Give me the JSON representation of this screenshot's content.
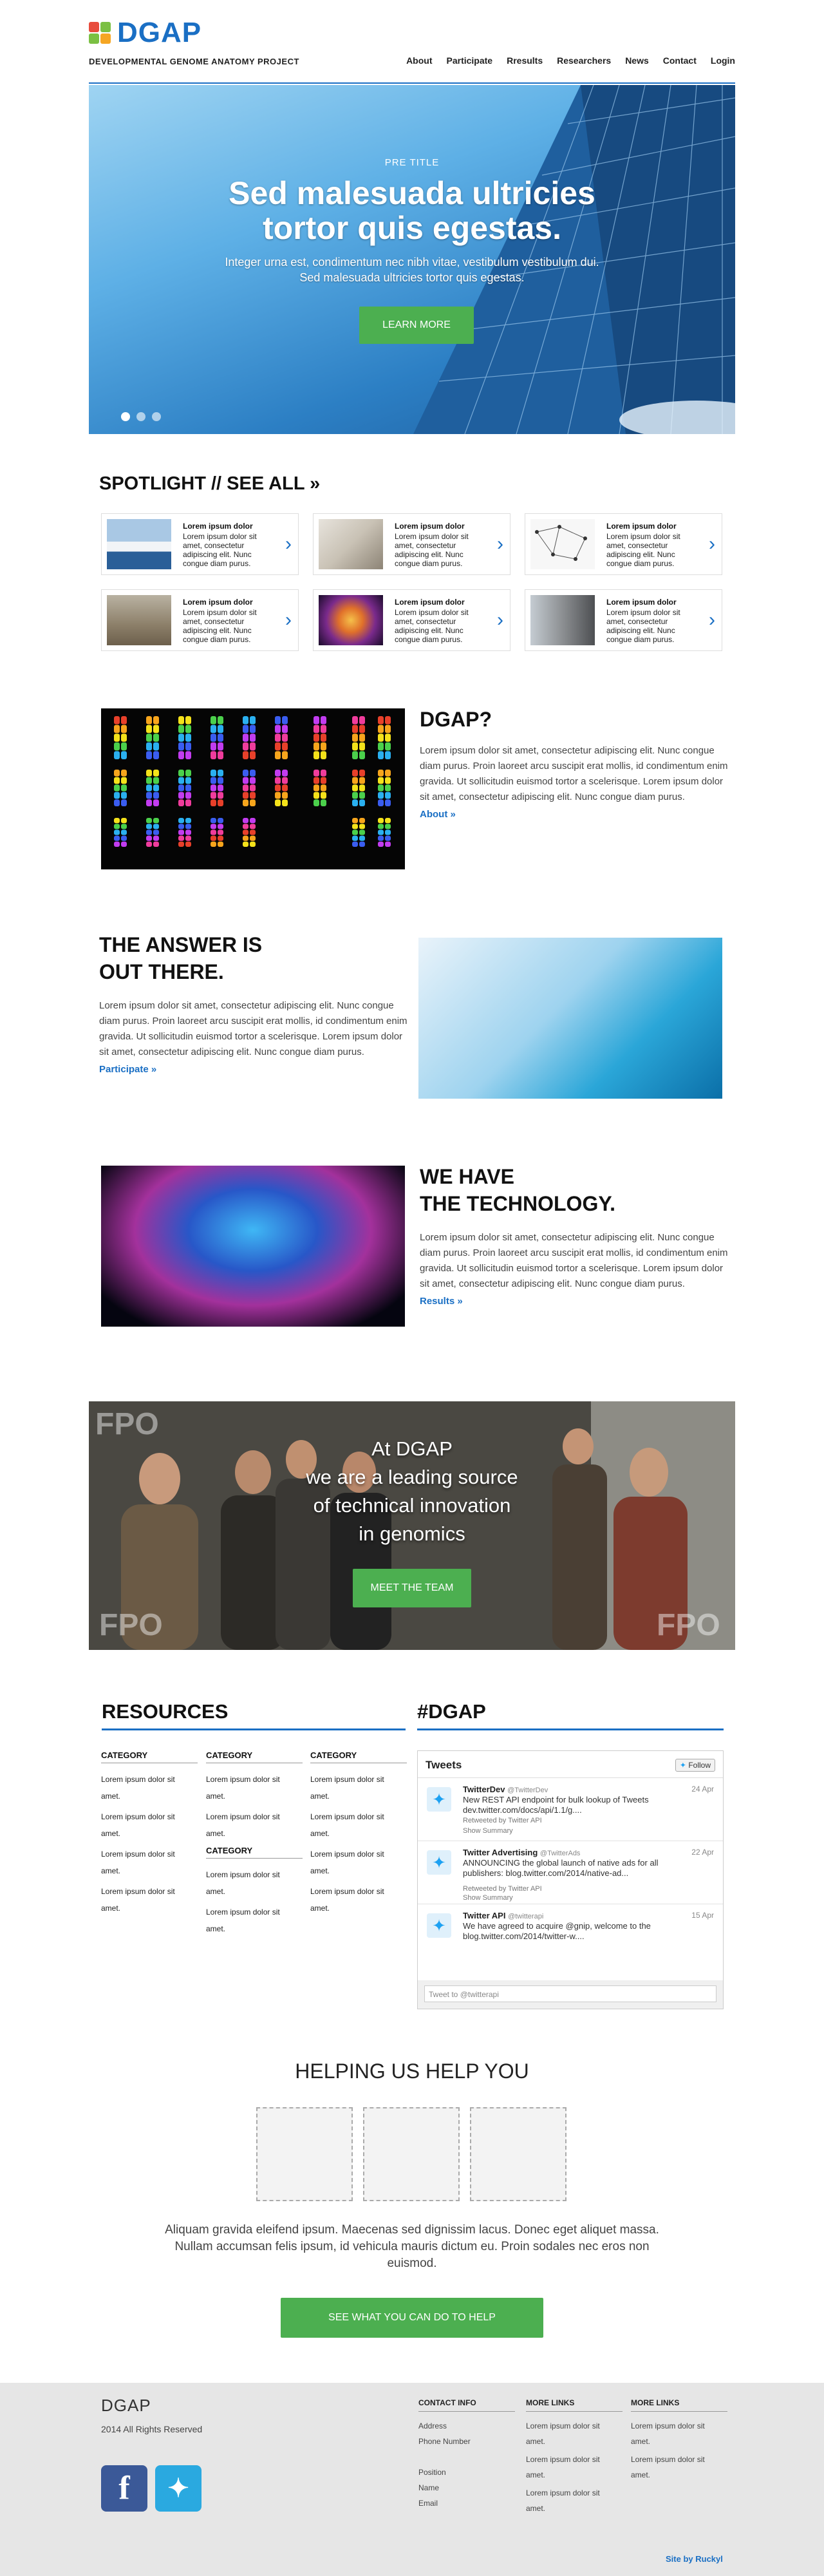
{
  "header": {
    "logo": "DGAP",
    "subtitle": "DEVELOPMENTAL GENOME ANATOMY PROJECT",
    "nav": [
      "About",
      "Participate",
      "Rresults",
      "Researchers",
      "News",
      "Contact",
      "Login"
    ]
  },
  "hero": {
    "pretitle": "PRE TITLE",
    "title_line1": "Sed malesuada ultricies",
    "title_line2": "tortor quis egestas.",
    "desc_line1": "Integer urna est, condimentum nec nibh vitae, vestibulum vestibulum dui.",
    "desc_line2": "Sed malesuada ultricies tortor quis egestas.",
    "button": "LEARN MORE"
  },
  "spotlight": {
    "heading": "SPOTLIGHT // SEE ALL »",
    "cards": [
      {
        "title": "Lorem ipsum dolor",
        "desc": "Lorem ipsum dolor sit amet, consectetur adipiscing elit. Nunc congue diam purus."
      },
      {
        "title": "Lorem ipsum dolor",
        "desc": "Lorem ipsum dolor sit amet, consectetur adipiscing elit. Nunc congue diam purus."
      },
      {
        "title": "Lorem ipsum dolor",
        "desc": "Lorem ipsum dolor sit amet, consectetur adipiscing elit. Nunc congue diam purus."
      },
      {
        "title": "Lorem ipsum dolor",
        "desc": "Lorem ipsum dolor sit amet, consectetur adipiscing elit. Nunc congue diam purus."
      },
      {
        "title": "Lorem ipsum dolor",
        "desc": "Lorem ipsum dolor sit amet, consectetur adipiscing elit. Nunc congue diam purus."
      },
      {
        "title": "Lorem ipsum dolor",
        "desc": "Lorem ipsum dolor sit amet, consectetur adipiscing elit. Nunc congue diam purus."
      }
    ]
  },
  "features": [
    {
      "title_line1": "DGAP?",
      "title_line2": "",
      "body": "Lorem ipsum dolor sit amet, consectetur adipiscing elit. Nunc congue diam purus. Proin laoreet arcu suscipit erat mollis, id condimentum enim gravida. Ut sollicitudin euismod tortor a scelerisque. Lorem ipsum dolor sit amet, consectetur adipiscing elit. Nunc congue diam purus.",
      "link": "About »"
    },
    {
      "title_line1": "THE ANSWER IS",
      "title_line2": "OUT THERE.",
      "body": "Lorem ipsum dolor sit amet, consectetur adipiscing elit. Nunc congue diam purus. Proin laoreet arcu suscipit erat mollis, id condimentum enim gravida. Ut sollicitudin euismod tortor a scelerisque. Lorem ipsum dolor sit amet, consectetur adipiscing elit. Nunc congue diam purus.",
      "link": "Participate »"
    },
    {
      "title_line1": "WE HAVE",
      "title_line2": "THE TECHNOLOGY.",
      "body": "Lorem ipsum dolor sit amet, consectetur adipiscing elit. Nunc congue diam purus. Proin laoreet arcu suscipit erat mollis, id condimentum enim gravida. Ut sollicitudin euismod tortor a scelerisque. Lorem ipsum dolor sit amet, consectetur adipiscing elit. Nunc congue diam purus.",
      "link": "Results »"
    }
  ],
  "team": {
    "line1": "At DGAP",
    "line2": "we are a leading source",
    "line3": "of technical innovation",
    "line4": "in genomics",
    "button": "MEET THE TEAM",
    "fpo": "FPO"
  },
  "resources": {
    "heading": "RESOURCES",
    "item": "Lorem ipsum dolor sit amet.",
    "category": "CATEGORY"
  },
  "twitter": {
    "heading": "#DGAP",
    "widget_title": "Tweets",
    "follow": "Follow",
    "tweets": [
      {
        "name": "TwitterDev",
        "handle": "@TwitterDev",
        "date": "24 Apr",
        "text": "New REST API endpoint for bulk lookup of Tweets dev.twitter.com/docs/api/1.1/g....",
        "retweet": "Retweeted by Twitter API",
        "summary": "Show Summary"
      },
      {
        "name": "Twitter Advertising",
        "handle": "@TwitterAds",
        "date": "22 Apr",
        "text": "ANNOUNCING the global launch of native ads for all publishers: blog.twitter.com/2014/native-ad...",
        "retweet": "Retweeted by Twitter API",
        "summary": "Show Summary"
      },
      {
        "name": "Twitter API",
        "handle": "@twitterapi",
        "date": "15 Apr",
        "text": "We have agreed to acquire @gnip, welcome to the blog.twitter.com/2014/twitter-w....",
        "retweet": "",
        "summary": ""
      }
    ],
    "compose": "Tweet to @twitterapi"
  },
  "help": {
    "heading": "HELPING US HELP YOU",
    "text_line1": "Aliquam gravida eleifend ipsum. Maecenas sed dignissim lacus. Donec eget aliquet massa.",
    "text_line2": "Nullam accumsan felis ipsum, id vehicula mauris dictum eu. Proin sodales nec eros non",
    "text_line3": "euismod.",
    "button": "SEE WHAT YOU CAN DO TO HELP"
  },
  "footer": {
    "logo": "DGAP",
    "copyright": "2014 All Rights Reserved",
    "contact_heading": "CONTACT INFO",
    "contact": [
      "Address",
      "Phone Number",
      "",
      "Position",
      "Name",
      "Email"
    ],
    "more_heading": "MORE LINKS",
    "more_item": "Lorem ipsum dolor sit amet.",
    "site": "Site by Ruckyl"
  },
  "colors": {
    "brand_blue": "#1a6fc4",
    "green": "#4caf50"
  }
}
